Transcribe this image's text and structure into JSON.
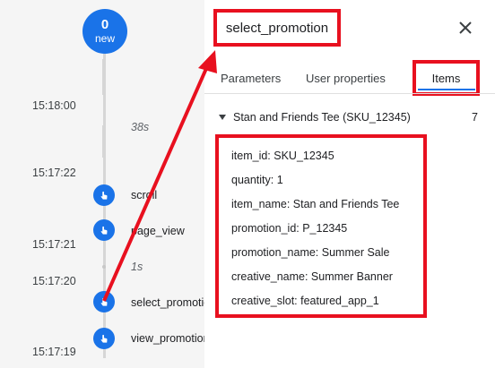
{
  "left_panel": {
    "new_count": "0",
    "new_label": "new",
    "times": [
      "15:18:00",
      "15:17:22",
      "15:17:21",
      "15:17:20",
      "15:17:19"
    ],
    "durations": [
      "38s",
      "1s"
    ],
    "events": [
      {
        "name": "scroll",
        "icon": "touch-icon"
      },
      {
        "name": "page_view",
        "icon": "touch-icon"
      },
      {
        "name": "select_promotion",
        "icon": "touch-icon"
      },
      {
        "name": "view_promotion",
        "icon": "touch-icon"
      }
    ]
  },
  "detail_panel": {
    "title": "select_promotion",
    "close_icon": "close-icon",
    "tabs": [
      {
        "label": "Parameters"
      },
      {
        "label": "User properties"
      },
      {
        "label": "Items"
      }
    ],
    "item_header": "Stan and Friends Tee (SKU_12345)",
    "item_count": "7",
    "params": [
      "item_id: SKU_12345",
      "quantity: 1",
      "item_name: Stan and Friends Tee",
      "promotion_id: P_12345",
      "promotion_name: Summer Sale",
      "creative_name: Summer Banner",
      "creative_slot: featured_app_1"
    ]
  },
  "colors": {
    "accent": "#1a73e8",
    "highlight": "#e8101f"
  }
}
